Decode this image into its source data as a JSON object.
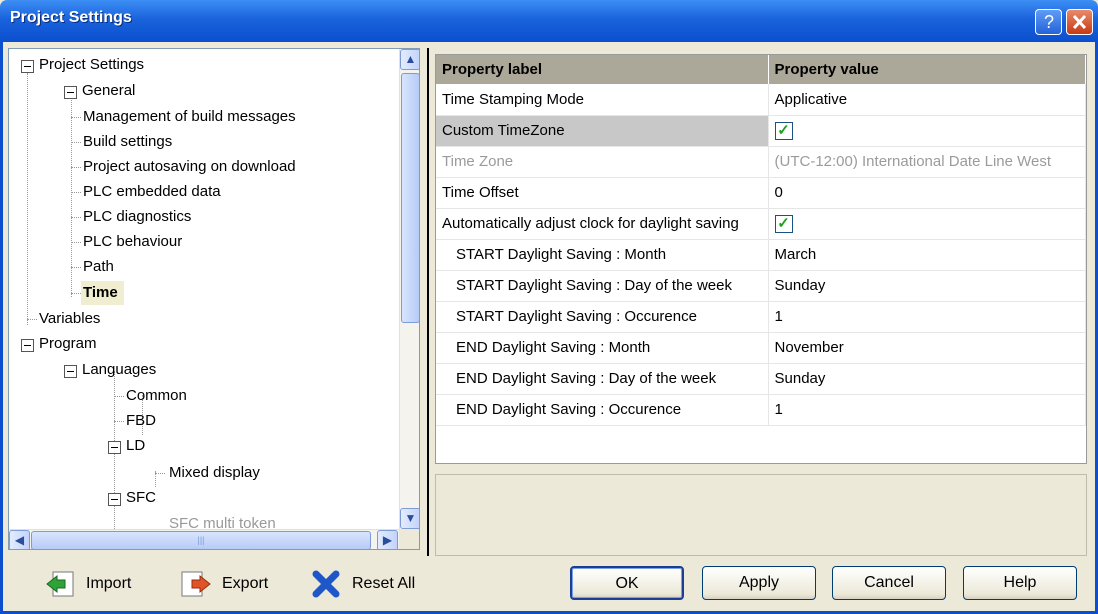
{
  "window": {
    "title": "Project Settings"
  },
  "tree": {
    "root": "Project Settings",
    "general": "General",
    "general_items": [
      "Management of build messages",
      "Build settings",
      "Project autosaving on download",
      "PLC embedded data",
      "PLC diagnostics",
      "PLC behaviour",
      "Path"
    ],
    "selected": "Time",
    "variables": "Variables",
    "program": "Program",
    "languages": "Languages",
    "common": "Common",
    "fbd": "FBD",
    "ld": "LD",
    "mixed": "Mixed display",
    "sfc": "SFC",
    "sfc_multi": "SFC multi token"
  },
  "grid": {
    "header_label": "Property label",
    "header_value": "Property value",
    "rows": [
      {
        "label": "Time Stamping Mode",
        "value": "Applicative"
      },
      {
        "label": "Custom TimeZone",
        "value": "checked"
      },
      {
        "label": "Time Zone",
        "value": "(UTC-12:00) International Date Line West"
      },
      {
        "label": "Time Offset",
        "value": "0"
      },
      {
        "label": "Automatically adjust clock for daylight saving",
        "value": "checked"
      },
      {
        "label": "START Daylight Saving : Month",
        "value": "March"
      },
      {
        "label": "START Daylight Saving : Day of the week",
        "value": "Sunday"
      },
      {
        "label": "START Daylight Saving : Occurence",
        "value": "1"
      },
      {
        "label": "END Daylight Saving : Month",
        "value": "November"
      },
      {
        "label": "END Daylight Saving : Day of the week",
        "value": "Sunday"
      },
      {
        "label": "END Daylight Saving : Occurence",
        "value": "1"
      }
    ]
  },
  "toolbar": {
    "import": "Import",
    "export": "Export",
    "reset": "Reset All"
  },
  "buttons": {
    "ok": "OK",
    "apply": "Apply",
    "cancel": "Cancel",
    "help": "Help"
  },
  "colors": {
    "title_bar": "#0b4fcf",
    "header": "#aca899",
    "check": "#21a121"
  }
}
